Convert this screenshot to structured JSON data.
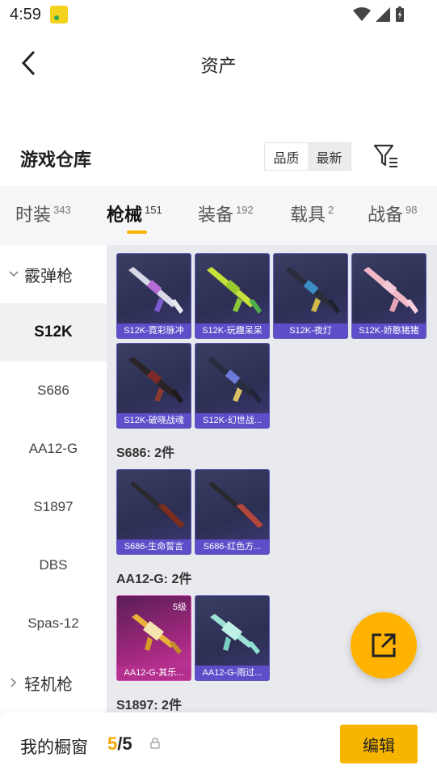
{
  "status_bar": {
    "time": "4:59"
  },
  "header": {
    "title": "资产"
  },
  "warehouse": {
    "title": "游戏仓库",
    "sort_quality": "品质",
    "sort_newest": "最新"
  },
  "tabs": [
    {
      "label": "时装",
      "count": "343"
    },
    {
      "label": "枪械",
      "count": "151"
    },
    {
      "label": "装备",
      "count": "192"
    },
    {
      "label": "载具",
      "count": "2"
    },
    {
      "label": "战备",
      "count": "98"
    }
  ],
  "nav": {
    "group_shotgun": "霰弹枪",
    "items": [
      "S12K",
      "S686",
      "AA12-G",
      "S1897",
      "DBS",
      "Spas-12"
    ],
    "group_lmg": "轻机枪"
  },
  "cards": [
    "S12K-霓彩脉冲",
    "S12K-玩趣呆呆",
    "S12K-夜灯",
    "S12K-娇憨猪猪",
    "S12K-破晓战魂",
    "S12K-幻世战...",
    "S686-生命誓言",
    "S686-红色方...",
    "AA12-G-其乐...",
    "AA12-G-雨过..."
  ],
  "card_level": "5级",
  "sections": {
    "s686": "S686: 2件",
    "aa12g": "AA12-G: 2件",
    "s1897": "S1897: 2件"
  },
  "bottom": {
    "label": "我的橱窗",
    "current": "5",
    "separator": "/",
    "total": "5",
    "edit": "编辑"
  },
  "colors": {
    "accent": "#f7b500",
    "card_label": "#5e4ec9",
    "card_label_pink": "#b3308f"
  }
}
